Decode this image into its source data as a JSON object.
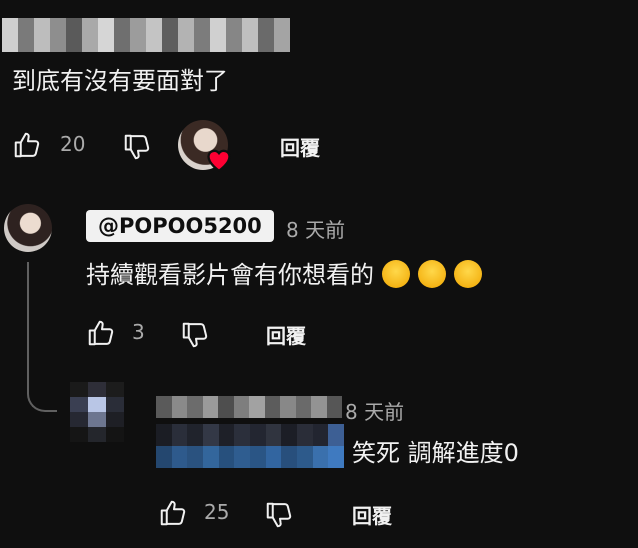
{
  "top_comment": {
    "text": "到底有沒有要面對了",
    "like_count": "20",
    "reply_label": "回覆"
  },
  "reply_1": {
    "handle": "@POPOO5200",
    "time": "8 天前",
    "text": "持續觀看影片會有你想看的",
    "emoji_count": 3,
    "like_count": "3",
    "reply_label": "回覆"
  },
  "reply_2": {
    "time": "8 天前",
    "text": "笑死 調解進度0",
    "like_count": "25",
    "reply_label": "回覆"
  },
  "icons": {
    "like": "thumbs-up-icon",
    "dislike": "thumbs-down-icon",
    "creator_heart": "heart-icon"
  },
  "colors": {
    "background": "#0f0f0f",
    "text": "#f1f1f1",
    "muted": "#aaaaaa",
    "heart": "#ff0033",
    "handle_bg": "#f1f1f1"
  }
}
